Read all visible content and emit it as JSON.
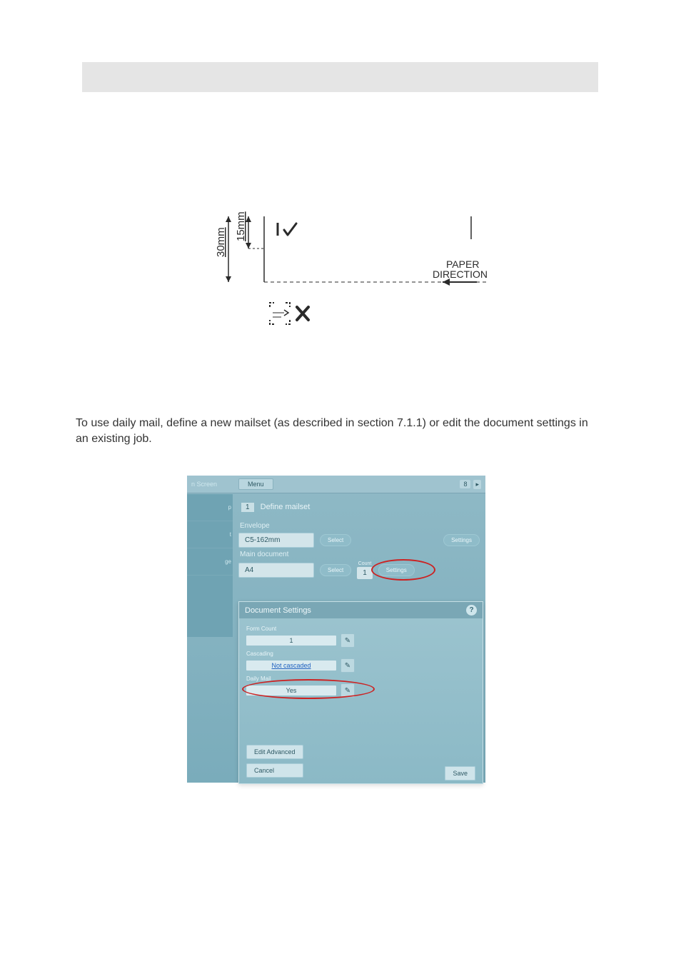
{
  "diagram": {
    "dim_a": "30mm",
    "dim_b": "15mm",
    "paper_direction": "PAPER\nDIRECTION"
  },
  "paragraph": "To use daily mail, define a new mailset (as described in section 7.1.1) or edit the document settings in an existing job.",
  "ui": {
    "topbar": {
      "left_label": "n Screen",
      "menu": "Menu",
      "counter": "8"
    },
    "left_tabs": [
      "p",
      "t",
      "ge"
    ],
    "step": {
      "num": "1",
      "label": "Define mailset"
    },
    "envelope": {
      "section": "Envelope",
      "value": "C5-162mm",
      "select": "Select",
      "settings": "Settings"
    },
    "maindoc": {
      "section": "Main document",
      "value": "A4",
      "select": "Select",
      "count_label": "Count",
      "count": "1",
      "settings": "Settings"
    },
    "dialog": {
      "title": "Document Settings",
      "help": "?",
      "form_count_label": "Form Count",
      "form_count": "1",
      "cascading_label": "Cascading",
      "cascading": "Not cascaded",
      "daily_label": "Daily Mail",
      "daily": "Yes",
      "edit_adv": "Edit Advanced",
      "cancel": "Cancel",
      "save": "Save"
    }
  }
}
